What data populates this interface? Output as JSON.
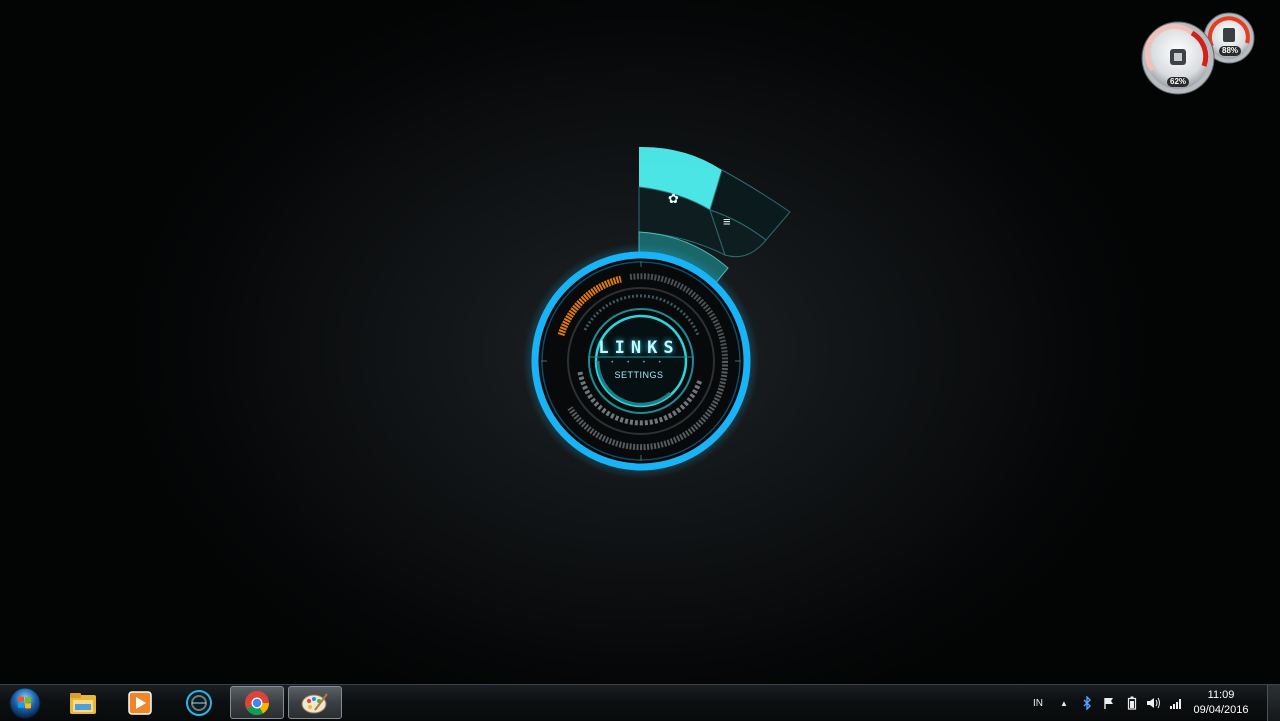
{
  "gadget": {
    "cpu_percent": "62%",
    "memory_percent": "88%",
    "cpu_value": 62,
    "memory_value": 88,
    "accent": "#d4201a"
  },
  "hud": {
    "title": "LINKS",
    "dots": "• • • •",
    "subtitle": "SETTINGS",
    "menu": [
      {
        "icon": "gear-icon",
        "glyph": "✿"
      },
      {
        "icon": "list-icon",
        "glyph": "≡"
      }
    ],
    "accent": "#1fc4ff",
    "orange": "#e07a10"
  },
  "taskbar": {
    "apps": [
      {
        "name": "windows-explorer",
        "icon": "folder-icon"
      },
      {
        "name": "media-player",
        "icon": "play-icon"
      },
      {
        "name": "rainmeter",
        "icon": "gear-ring-icon"
      },
      {
        "name": "google-chrome",
        "icon": "chrome-icon"
      },
      {
        "name": "paint",
        "icon": "palette-icon"
      }
    ],
    "language": "IN",
    "clock_time": "11:09",
    "clock_date": "09/04/2016"
  }
}
